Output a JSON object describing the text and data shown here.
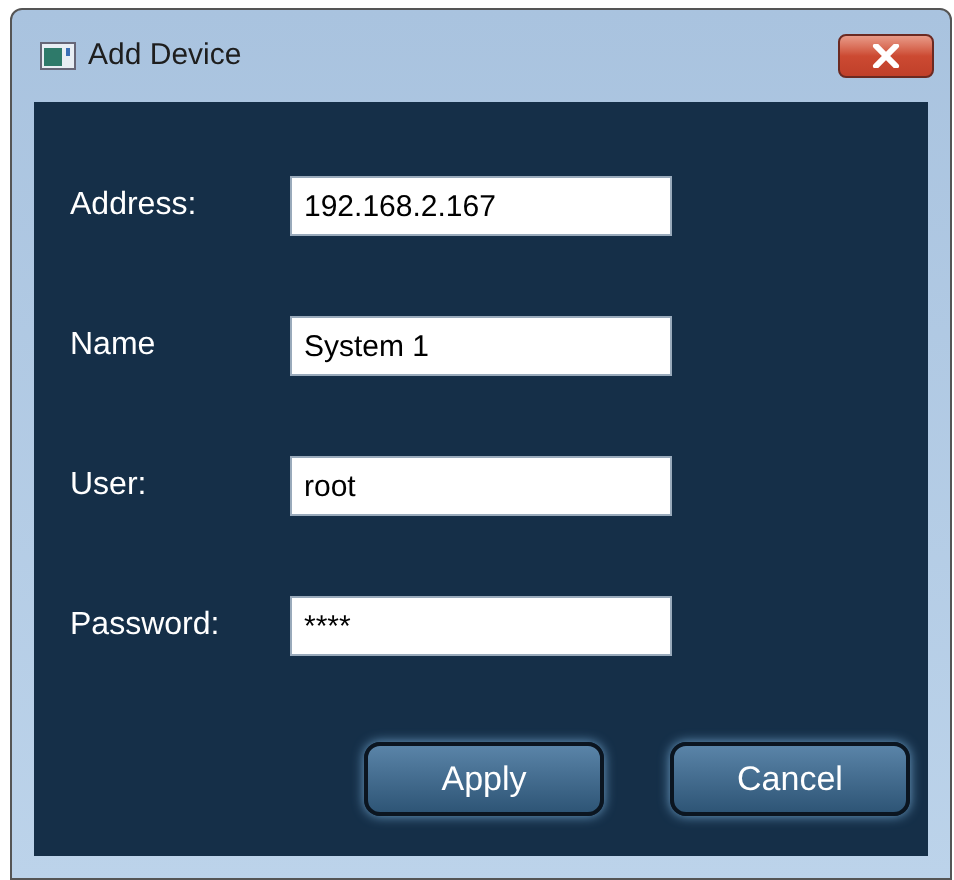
{
  "window": {
    "title": "Add Device"
  },
  "fields": [
    {
      "label": "Address:",
      "value": "192.168.2.167"
    },
    {
      "label": "Name",
      "value": "System 1"
    },
    {
      "label": "User:",
      "value": "root"
    },
    {
      "label": "Password:",
      "value": "****"
    }
  ],
  "buttons": [
    "Apply",
    "Cancel"
  ]
}
